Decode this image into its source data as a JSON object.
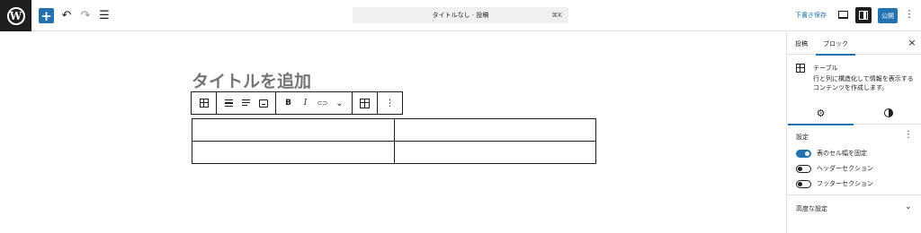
{
  "topbar": {
    "logo_letter": "W",
    "add_icon": "+",
    "undo_icon": "↶",
    "redo_icon": "↷",
    "listview_icon": "☰",
    "command_title": "タイトルなし · 投稿",
    "command_shortcut": "⌘K",
    "save_draft_label": "下書き保存",
    "publish_label": "公開",
    "more_icon": "⋮"
  },
  "editor": {
    "title_placeholder": "タイトルを追加",
    "toolbar": {
      "bold": "B",
      "italic": "I",
      "link": "⊂⊃",
      "chevron": "⌄",
      "more": "⋮"
    },
    "table": {
      "rows": 2,
      "cols": 2
    }
  },
  "sidebar": {
    "tab_post": "投稿",
    "tab_block": "ブロック",
    "close_icon": "×",
    "block_name": "テーブル",
    "block_description": "行と列に構造化して情報を表示するコンテンツを作成します。",
    "gear_icon": "⚙",
    "panel_title": "設定",
    "panel_more": "⋮",
    "toggles": [
      {
        "label": "表のセル幅を固定",
        "on": true
      },
      {
        "label": "ヘッダーセクション",
        "on": false
      },
      {
        "label": "フッターセクション",
        "on": false
      }
    ],
    "advanced_label": "高度な設定",
    "advanced_chevron": "⌄"
  },
  "colors": {
    "accent": "#2271b1",
    "dark": "#1e1e1e",
    "placeholder": "#757575"
  }
}
